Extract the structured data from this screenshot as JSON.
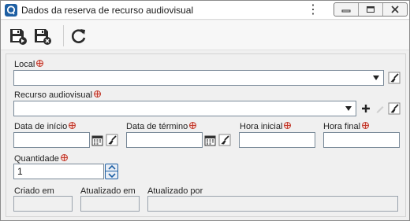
{
  "window": {
    "title": "Dados da reserva de recurso audiovisual",
    "menu_glyph": "⋮",
    "controls": [
      "minimize-icon",
      "maximize-icon",
      "close-icon"
    ]
  },
  "toolbar": {
    "buttons": [
      "save-and-new-icon",
      "save-and-close-icon",
      "refresh-icon"
    ]
  },
  "form": {
    "local": {
      "label": "Local",
      "value": ""
    },
    "recurso": {
      "label": "Recurso audiovisual",
      "value": ""
    },
    "data_inicio": {
      "label": "Data de início",
      "value": ""
    },
    "data_termino": {
      "label": "Data de término",
      "value": ""
    },
    "hora_inicial": {
      "label": "Hora inicial",
      "value": ""
    },
    "hora_final": {
      "label": "Hora final",
      "value": ""
    },
    "quantidade": {
      "label": "Quantidade",
      "value": "1"
    },
    "criado_em": {
      "label": "Criado em",
      "value": ""
    },
    "atualizado_em": {
      "label": "Atualizado em",
      "value": ""
    },
    "atualizado_por": {
      "label": "Atualizado por",
      "value": ""
    }
  },
  "colors": {
    "accent": "#1e5fa3",
    "required": "#c0392b",
    "background": "#f0f0f0"
  }
}
